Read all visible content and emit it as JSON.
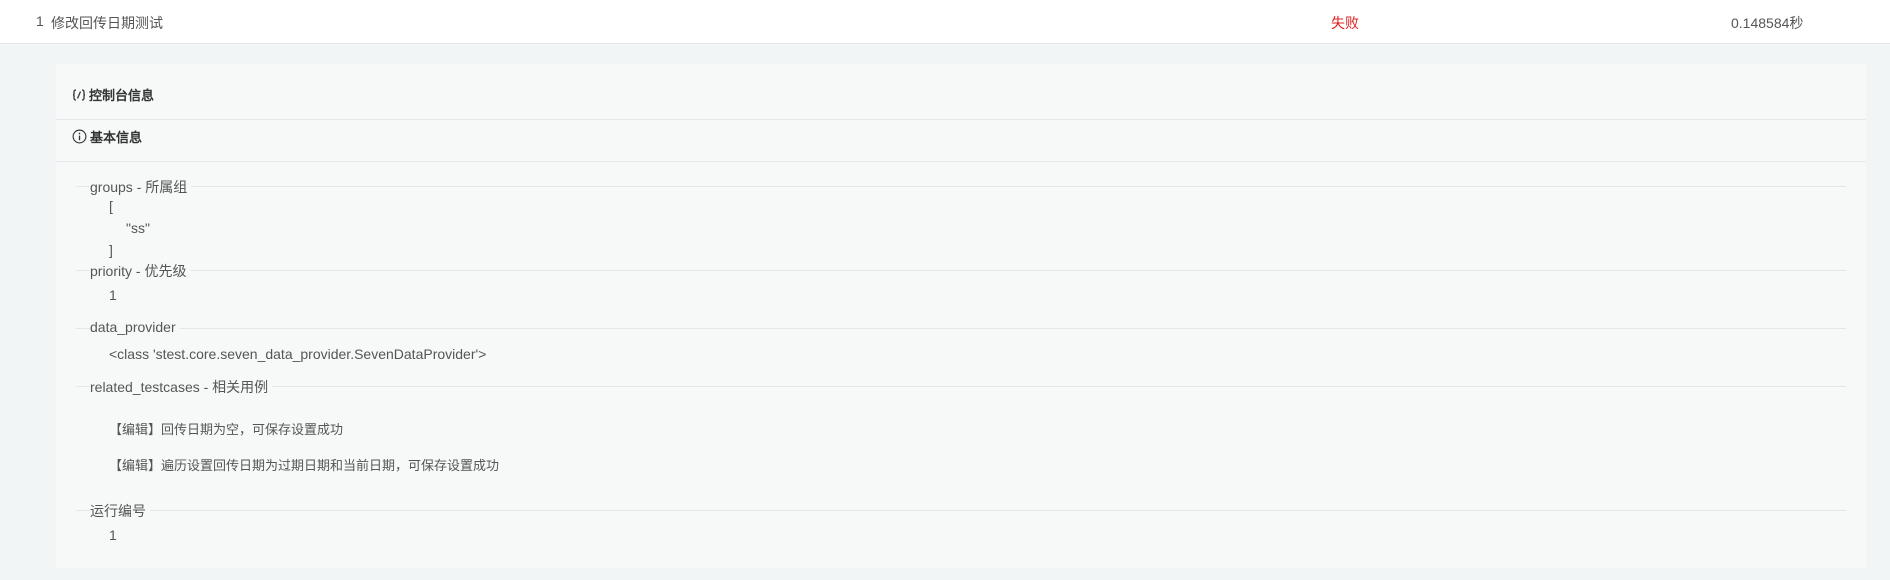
{
  "row": {
    "index": "1",
    "name": "修改回传日期测试",
    "status": "失败",
    "status_color": "#e02020",
    "duration": "0.148584秒"
  },
  "sections": {
    "console_title": "控制台信息",
    "console_icon": "code-icon",
    "basic_title": "基本信息",
    "basic_icon": "info-circle-icon"
  },
  "fields": {
    "groups": {
      "legend": "groups - 所属组",
      "open": "[",
      "item": "\"ss\"",
      "close": "]"
    },
    "priority": {
      "legend": "priority - 优先级",
      "value": "1"
    },
    "data_provider": {
      "legend": "data_provider",
      "value": "<class 'stest.core.seven_data_provider.SevenDataProvider'>"
    },
    "related_testcases": {
      "legend": "related_testcases - 相关用例",
      "items": [
        "【编辑】回传日期为空，可保存设置成功",
        "【编辑】遍历设置回传日期为过期日期和当前日期，可保存设置成功"
      ]
    },
    "run_number": {
      "legend": "运行编号",
      "value": "1"
    }
  }
}
